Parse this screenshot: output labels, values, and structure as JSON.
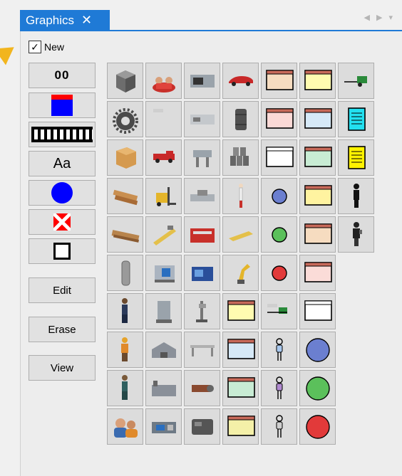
{
  "tab": {
    "title": "Graphics",
    "close_glyph": "✕"
  },
  "scroll": {
    "left_glyph": "◀",
    "right_glyph": "▶",
    "menu_glyph": "▾"
  },
  "new_checkbox": {
    "label": "New",
    "checked": true
  },
  "tools": {
    "number_label": "00",
    "text_label": "Aa",
    "shapes": [
      "rectangle-swatch",
      "conveyor-swatch",
      "circle-swatch",
      "x-box-swatch",
      "square-outline-swatch"
    ]
  },
  "buttons": {
    "edit": "Edit",
    "erase": "Erase",
    "view": "View"
  },
  "colors": {
    "tab_blue": "#1f7ad6",
    "pointer_orange": "#f2b51e",
    "swatch_blue": "#0000ff",
    "swatch_red": "#ff0000",
    "cell_bg": "#dcdcdc"
  },
  "gallery": {
    "columns": [
      [
        "box-3d-icon",
        "gear-icon",
        "cardboard-box-icon",
        "lumber-icon",
        "wood-pallet-icon",
        "cylinder-tank-icon",
        "worker-icon",
        "hardhat-worker-icon",
        "operator-icon",
        "meeting-people-icon"
      ],
      [
        "seated-people-icon",
        "small-label-icon",
        "red-truck-icon",
        "forklift-icon",
        "tool-arm-icon",
        "drill-press-icon",
        "tank-machine-icon",
        "warehouse-icon",
        "factory-icon",
        "cnc-machine-icon"
      ],
      [
        "cnc-lathe-icon",
        "lathe-machine-icon",
        "press-machine-icon",
        "grinder-icon",
        "press-brake-icon",
        "blue-machine-icon",
        "drill-stand-icon",
        "workbench-icon",
        "gear-pump-icon",
        "engine-block-icon"
      ],
      [
        "red-car-icon",
        "oil-barrel-icon",
        "stacked-barrels-icon",
        "standing-person-icon",
        "yellow-tool-icon",
        "robot-arm-icon",
        "queue-box-yellow-icon",
        "queue-box-blue-icon",
        "queue-box-green-icon",
        "queue-box-yellow2-icon"
      ],
      [
        "queue-box-orange-icon",
        "queue-box-red-icon",
        "queue-box-white-icon",
        "blue-circle-icon",
        "green-circle-icon",
        "red-circle-icon",
        "truck-label-icon",
        "person-blue-icon",
        "person-purple-icon",
        "person-gray-icon"
      ],
      [
        "queue-box-yellow-icon",
        "queue-box-lightblue-icon",
        "queue-box-mint-icon",
        "queue-box-yellow3-icon",
        "queue-box-peach-icon",
        "queue-box-pink-icon",
        "queue-box-outline-icon",
        "blue-ellipse-icon",
        "green-ellipse-icon",
        "red-ellipse-icon"
      ],
      [
        "delivery-truck-icon",
        "document-cyan-icon",
        "document-yellow-icon",
        "dark-worker-icon",
        "phone-worker-icon"
      ]
    ]
  }
}
